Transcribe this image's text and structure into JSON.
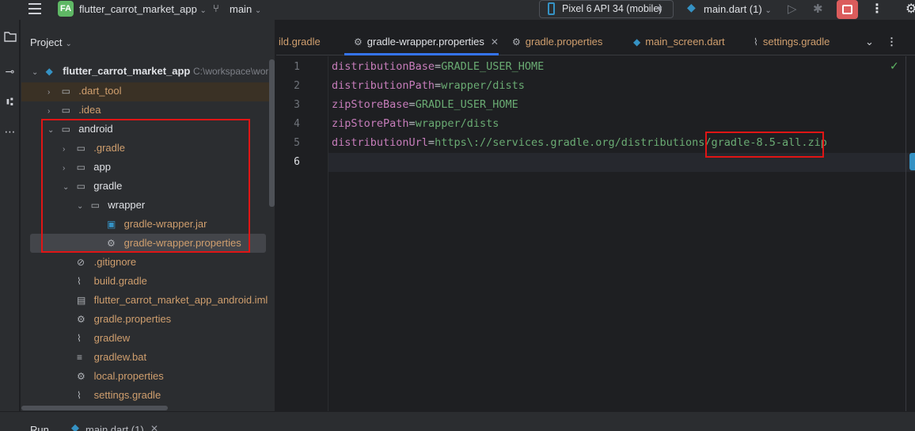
{
  "titlebar": {
    "project_badge": "FA",
    "project_name": "flutter_carrot_market_app",
    "branch": "main",
    "device": "Pixel 6 API 34 (mobile)",
    "run_config": "main.dart (1)"
  },
  "project_panel": {
    "header": "Project",
    "root_name": "flutter_carrot_market_app",
    "root_path": "C:\\workspace\\work",
    "items": [
      {
        "label": ".dart_tool"
      },
      {
        "label": ".idea"
      },
      {
        "label": "android"
      },
      {
        "label": ".gradle"
      },
      {
        "label": "app"
      },
      {
        "label": "gradle"
      },
      {
        "label": "wrapper"
      },
      {
        "label": "gradle-wrapper.jar"
      },
      {
        "label": "gradle-wrapper.properties"
      },
      {
        "label": ".gitignore"
      },
      {
        "label": "build.gradle"
      },
      {
        "label": "flutter_carrot_market_app_android.iml"
      },
      {
        "label": "gradle.properties"
      },
      {
        "label": "gradlew"
      },
      {
        "label": "gradlew.bat"
      },
      {
        "label": "local.properties"
      },
      {
        "label": "settings.gradle"
      }
    ]
  },
  "editor": {
    "tabs": [
      {
        "label": "ild.gradle"
      },
      {
        "label": "gradle-wrapper.properties"
      },
      {
        "label": "gradle.properties"
      },
      {
        "label": "main_screen.dart"
      },
      {
        "label": "settings.gradle"
      }
    ],
    "lines": [
      {
        "no": "1",
        "key": "distributionBase",
        "value": "GRADLE_USER_HOME"
      },
      {
        "no": "2",
        "key": "distributionPath",
        "value": "wrapper/dists"
      },
      {
        "no": "3",
        "key": "zipStoreBase",
        "value": "GRADLE_USER_HOME"
      },
      {
        "no": "4",
        "key": "zipStorePath",
        "value": "wrapper/dists"
      },
      {
        "no": "5",
        "key": "distributionUrl",
        "value": "https\\://services.gradle.org/distributions/gradle-8.5-all.zip"
      },
      {
        "no": "6",
        "key": "",
        "value": ""
      }
    ]
  },
  "bottom": {
    "run_label": "Run",
    "run_tab": "main.dart (1)"
  },
  "colors": {
    "accent": "#3574f0",
    "highlight_box": "#e01515",
    "project_badge": "#5fb865"
  }
}
